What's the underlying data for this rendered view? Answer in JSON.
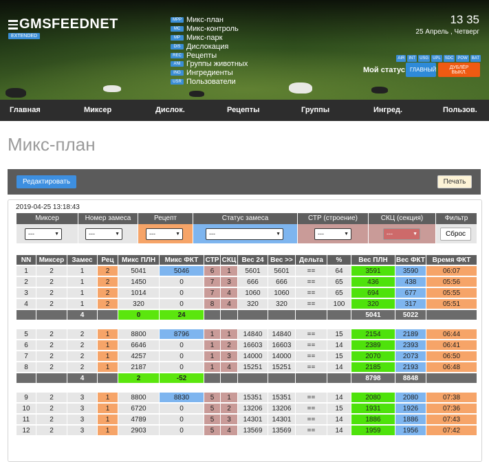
{
  "brand": {
    "name": "GMSFEEDNET",
    "edition": "EXTENDED"
  },
  "menu": [
    {
      "tag": "MPP",
      "label": "Микс-план"
    },
    {
      "tag": "MC",
      "label": "Микс-контроль"
    },
    {
      "tag": "MP",
      "label": "Микс-парк"
    },
    {
      "tag": "DIS",
      "label": "Дислокация"
    },
    {
      "tag": "REC",
      "label": "Рецепты"
    },
    {
      "tag": "ANI",
      "label": "Группы животных"
    },
    {
      "tag": "ING",
      "label": "Ингредиенты"
    },
    {
      "tag": "USR",
      "label": "Пользователи"
    }
  ],
  "clock": {
    "time": "13 35",
    "date": "25 Апрель , Четверг"
  },
  "badges": [
    "AIR",
    "INT",
    "USG",
    "UPL",
    "SDC",
    "POW",
    "BAT"
  ],
  "status": {
    "label": "Мой статус",
    "main": "ГЛАВНЫЙ",
    "duplicate": "ДУБЛЁР ВЫКЛ."
  },
  "nav": [
    "Главная",
    "Миксер",
    "Дислок.",
    "Рецепты",
    "Группы",
    "Ингред.",
    "Пользов."
  ],
  "page_title": "Микс-план",
  "toolbar": {
    "edit": "Редактировать",
    "print": "Печать"
  },
  "timestamp": "2019-04-25 13:18:43",
  "filters": {
    "mixer": {
      "label": "Миксер",
      "value": "---"
    },
    "batch": {
      "label": "Номер замеса",
      "value": "---"
    },
    "recipe": {
      "label": "Рецепт",
      "value": "---"
    },
    "status": {
      "label": "Статус замеса",
      "value": "---"
    },
    "building": {
      "label": "СТР (строение)",
      "value": "---"
    },
    "section": {
      "label": "СКЦ (секция)",
      "value": "---"
    },
    "filter": {
      "label": "Фильтр",
      "reset": "Сброс"
    }
  },
  "columns": [
    "NN",
    "Миксер",
    "Замес",
    "Рец",
    "Микс ПЛН",
    "Микс ФКТ",
    "СТР",
    "СКЦ",
    "Вес 24",
    "Вес >>",
    "Дельта",
    "%",
    "Вес ПЛН",
    "Вес ФКТ",
    "Время ФКТ"
  ],
  "groups": [
    {
      "rows": [
        [
          "1",
          "2",
          "1",
          "2",
          "5041",
          "5046",
          "6",
          "1",
          "5601",
          "5601",
          "==",
          "64",
          "3591",
          "3590",
          "06:07"
        ],
        [
          "2",
          "2",
          "1",
          "2",
          "1450",
          "0",
          "7",
          "3",
          "666",
          "666",
          "==",
          "65",
          "436",
          "438",
          "05:56"
        ],
        [
          "3",
          "2",
          "1",
          "2",
          "1014",
          "0",
          "7",
          "4",
          "1060",
          "1060",
          "==",
          "65",
          "694",
          "677",
          "05:55"
        ],
        [
          "4",
          "2",
          "1",
          "2",
          "320",
          "0",
          "8",
          "4",
          "320",
          "320",
          "==",
          "100",
          "320",
          "317",
          "05:51"
        ]
      ],
      "summary": {
        "batch": "4",
        "plan": "0",
        "fact": "24",
        "weight_plan": "5041",
        "weight_fact": "5022"
      }
    },
    {
      "rows": [
        [
          "5",
          "2",
          "2",
          "1",
          "8800",
          "8796",
          "1",
          "1",
          "14840",
          "14840",
          "==",
          "15",
          "2154",
          "2189",
          "06:44"
        ],
        [
          "6",
          "2",
          "2",
          "1",
          "6646",
          "0",
          "1",
          "2",
          "16603",
          "16603",
          "==",
          "14",
          "2389",
          "2393",
          "06:41"
        ],
        [
          "7",
          "2",
          "2",
          "1",
          "4257",
          "0",
          "1",
          "3",
          "14000",
          "14000",
          "==",
          "15",
          "2070",
          "2073",
          "06:50"
        ],
        [
          "8",
          "2",
          "2",
          "1",
          "2187",
          "0",
          "1",
          "4",
          "15251",
          "15251",
          "==",
          "14",
          "2185",
          "2193",
          "06:48"
        ]
      ],
      "summary": {
        "batch": "4",
        "plan": "2",
        "fact": "-52",
        "weight_plan": "8798",
        "weight_fact": "8848"
      }
    },
    {
      "rows": [
        [
          "9",
          "2",
          "3",
          "1",
          "8800",
          "8830",
          "5",
          "1",
          "15351",
          "15351",
          "==",
          "14",
          "2080",
          "2080",
          "07:38"
        ],
        [
          "10",
          "2",
          "3",
          "1",
          "6720",
          "0",
          "5",
          "2",
          "13206",
          "13206",
          "==",
          "15",
          "1931",
          "1926",
          "07:36"
        ],
        [
          "11",
          "2",
          "3",
          "1",
          "4789",
          "0",
          "5",
          "3",
          "14301",
          "14301",
          "==",
          "14",
          "1886",
          "1886",
          "07:43"
        ],
        [
          "12",
          "2",
          "3",
          "1",
          "2903",
          "0",
          "5",
          "4",
          "13569",
          "13569",
          "==",
          "14",
          "1959",
          "1956",
          "07:42"
        ]
      ]
    }
  ]
}
